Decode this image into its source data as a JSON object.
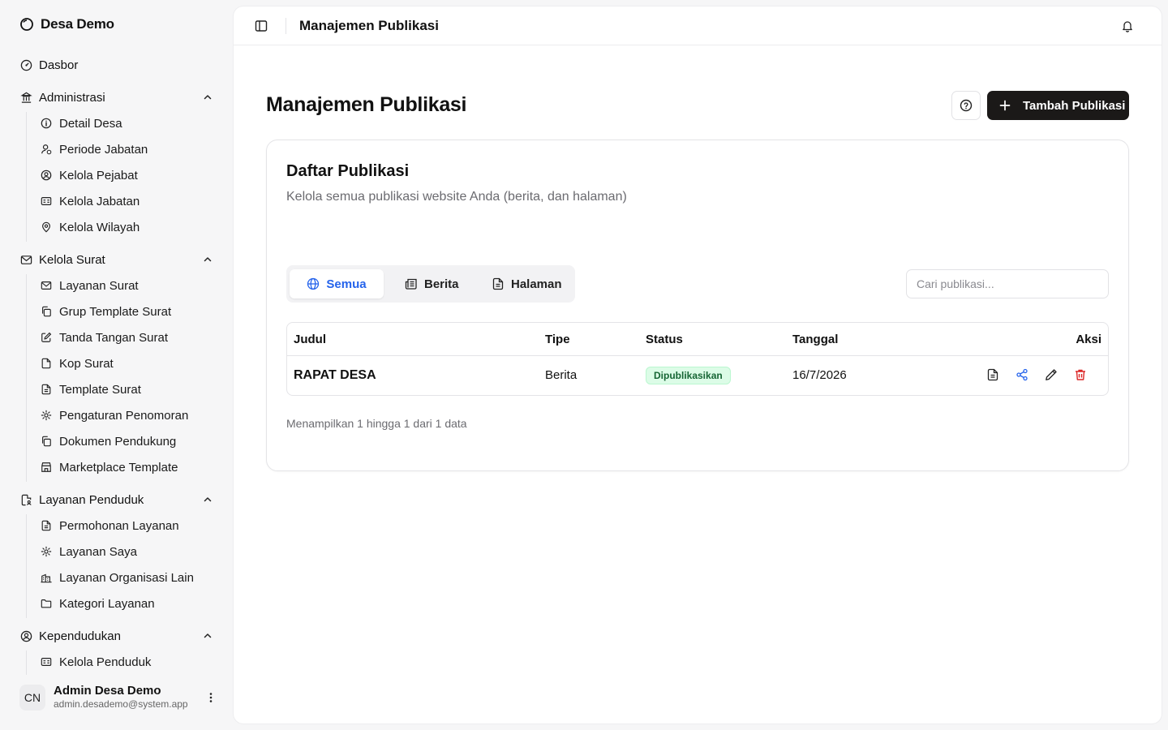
{
  "brand": {
    "name": "Desa Demo"
  },
  "nav": {
    "dashboard": "Dasbor",
    "groups": [
      {
        "label": "Administrasi",
        "items": [
          "Detail Desa",
          "Periode Jabatan",
          "Kelola Pejabat",
          "Kelola Jabatan",
          "Kelola Wilayah"
        ]
      },
      {
        "label": "Kelola Surat",
        "items": [
          "Layanan Surat",
          "Grup Template Surat",
          "Tanda Tangan Surat",
          "Kop Surat",
          "Template Surat",
          "Pengaturan Penomoran",
          "Dokumen Pendukung",
          "Marketplace Template"
        ]
      },
      {
        "label": "Layanan Penduduk",
        "items": [
          "Permohonan Layanan",
          "Layanan Saya",
          "Layanan Organisasi Lain",
          "Kategori Layanan"
        ]
      },
      {
        "label": "Kependudukan",
        "items": [
          "Kelola Penduduk"
        ]
      }
    ]
  },
  "user": {
    "initials": "CN",
    "name": "Admin Desa Demo",
    "email": "admin.desademo@system.app"
  },
  "topbar": {
    "title": "Manajemen Publikasi"
  },
  "page": {
    "title": "Manajemen Publikasi",
    "add_button": "Tambah Publikasi"
  },
  "card": {
    "title": "Daftar Publikasi",
    "description": "Kelola semua publikasi website Anda (berita, dan halaman)"
  },
  "tabs": [
    "Semua",
    "Berita",
    "Halaman"
  ],
  "search": {
    "placeholder": "Cari publikasi..."
  },
  "table": {
    "headers": [
      "Judul",
      "Tipe",
      "Status",
      "Tanggal",
      "Aksi"
    ],
    "rows": [
      {
        "title": "RAPAT DESA",
        "type": "Berita",
        "status": "Dipublikasikan",
        "date": "16/7/2026"
      }
    ]
  },
  "footer": {
    "summary": "Menampilkan 1 hingga 1 dari 1 data"
  },
  "colors": {
    "accent": "#2563eb",
    "primary_button": "#1b1918",
    "danger": "#dc2626",
    "success_bg": "#dcfce7",
    "success_text": "#166534"
  }
}
